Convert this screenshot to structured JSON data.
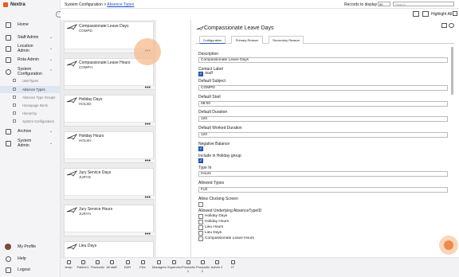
{
  "app": {
    "name": "Nextra",
    "accent": "#ea5a1d"
  },
  "nav": {
    "home": "Home",
    "staff_admin": "Staff Admin",
    "location_admin": "Location Admin",
    "rota_admin": "Rota Admin",
    "system_configuration": "System Configuration",
    "archive": "Archive",
    "system_admin": "System Admin",
    "my_profile": "My Profile",
    "help": "Help",
    "logout": "Logout",
    "sub": [
      "UserTypes",
      "Absence Types",
      "Absence Type Groups",
      "Homepage Items",
      "Hierarchy",
      "System Configuration"
    ]
  },
  "topbar": {
    "bc_root": "System Configuration > ",
    "bc_link": "Absence Types",
    "records_label": "Records to display",
    "records_value": "50",
    "search_placeholder": "Search"
  },
  "toolbar": {
    "highlight_all": "Highlight All"
  },
  "list": [
    {
      "name": "Compassionate Leave Days",
      "code": "COMPD"
    },
    {
      "name": "Compassionate Leave Hours",
      "code": "COMPH"
    },
    {
      "name": "Holiday Days",
      "code": "HOLSD"
    },
    {
      "name": "Holiday Hours",
      "code": "HOLSH"
    },
    {
      "name": "Jury Service Days",
      "code": "JURYD"
    },
    {
      "name": "Jury Service Hours",
      "code": "JURYH"
    },
    {
      "name": "Lieu Days",
      "code": ""
    }
  ],
  "detail": {
    "title": "Compassionate Leave Days",
    "tabs": [
      "Configuration",
      "Primary Reason",
      "Secondary Reason"
    ],
    "description_label": "Description",
    "description": "Compassionate Leave Days",
    "contact_label": "Contact Label",
    "contact_option": "Staff",
    "default_subject_label": "Default Subject",
    "default_subject": "COMPD",
    "default_start_label": "Default Start",
    "default_start": "08:00",
    "default_duration_label": "Default Duration",
    "default_duration": "120",
    "default_worked_label": "Default Worked Duration",
    "default_worked": "120",
    "negative_balance_label": "Negative Balance",
    "holiday_group_label": "Include in Holiday group",
    "type_in_label": "Type In",
    "type_in": "Hours",
    "allowed_types_label": "Allowed Types",
    "allowed_types": "Full",
    "allow_clocking_label": "Allow Clocking Screen",
    "allowed_underlying_label": "Allowed Underlying AbsenceTypeID",
    "underlying": [
      "Holiday Days",
      "Holiday Hours",
      "Lieu Hours",
      "Lieu Days",
      "Compassionate Leave Hours"
    ]
  },
  "bottom": [
    "temp",
    "Pattern1",
    "Productio",
    "All staff",
    "E&R",
    "Flex",
    "Managers",
    "Supervisc",
    "Productio 1",
    "Productio 2",
    "Admin 2",
    "IT"
  ]
}
